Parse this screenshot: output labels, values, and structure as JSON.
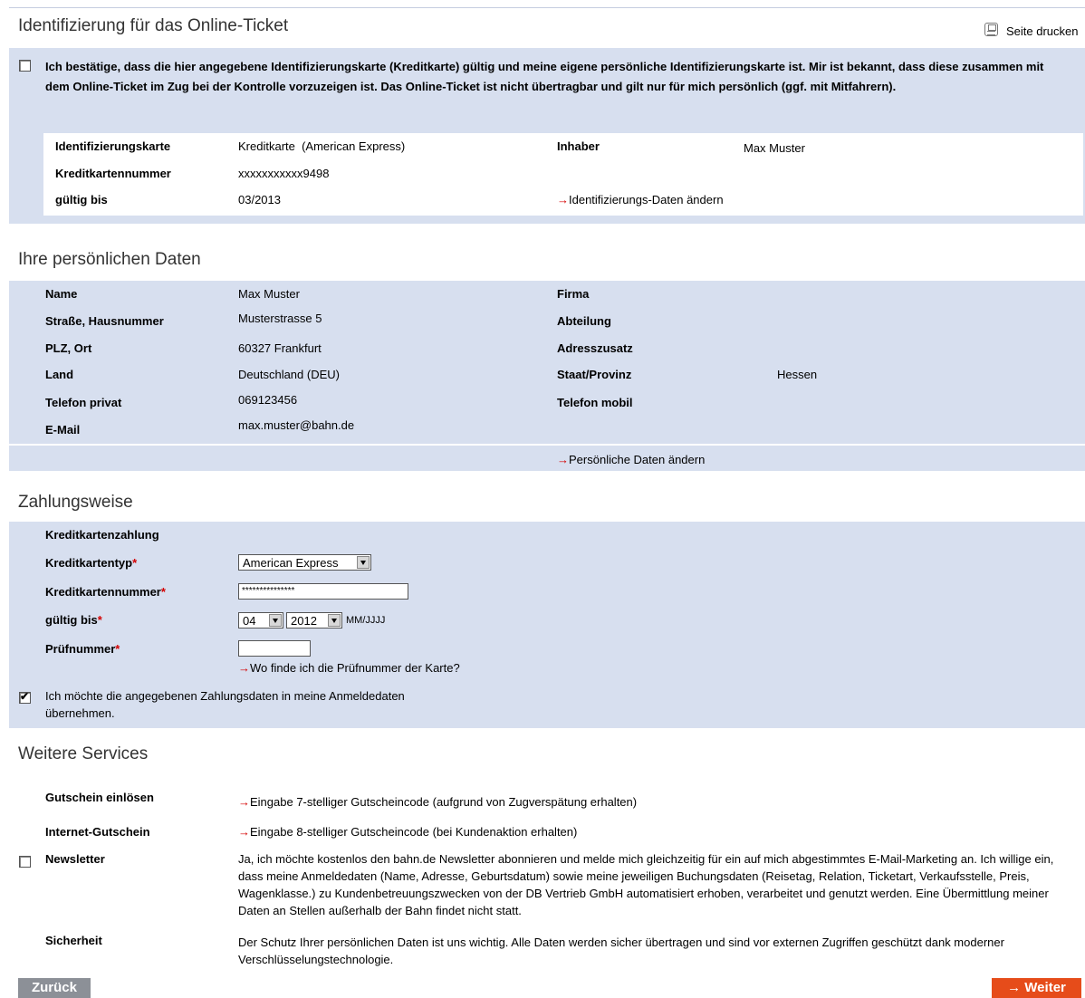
{
  "ident": {
    "title": "Identifizierung für das Online-Ticket",
    "print_label": "Seite drucken",
    "confirm_text": "Ich bestätige, dass die hier angegebene Identifizierungskarte (Kreditkarte) gültig und meine eigene persönliche Identifizierungskarte ist. Mir ist bekannt, dass diese zusammen mit dem Online-Ticket im Zug bei der Kontrolle vorzuzeigen ist. Das Online-Ticket ist nicht übertragbar und gilt nur für mich persönlich (ggf. mit Mitfahrern).",
    "card_label": "Identifizierungskarte",
    "card_value": "Kreditkarte  (American Express)",
    "owner_label": "Inhaber",
    "owner_value": "Max Muster",
    "number_label": "Kreditkartennummer",
    "number_value": "xxxxxxxxxxx9498",
    "valid_label": "gültig bis",
    "valid_value": "03/2013",
    "change_link": "Identifizierungs-Daten ändern"
  },
  "personal": {
    "title": "Ihre persönlichen Daten",
    "name_label": "Name",
    "name_value": "Max Muster",
    "company_label": "Firma",
    "street_label": "Straße, Hausnummer",
    "street_value": "Musterstrasse 5",
    "department_label": "Abteilung",
    "city_label": "PLZ, Ort",
    "city_value": "60327 Frankfurt",
    "address_extra_label": "Adresszusatz",
    "country_label": "Land",
    "country_value": "Deutschland (DEU)",
    "state_label": "Staat/Provinz",
    "state_value": "Hessen",
    "phone_label": "Telefon privat",
    "phone_value": "069123456",
    "mobile_label": "Telefon mobil",
    "email_label": "E-Mail",
    "email_value": "max.muster@bahn.de",
    "change_link": "Persönliche Daten ändern"
  },
  "payment": {
    "title": "Zahlungsweise",
    "method": "Kreditkartenzahlung",
    "type_label": "Kreditkartentyp",
    "type_value": "American Express",
    "number_label": "Kreditkartennummer",
    "number_value": "***************",
    "valid_label": "gültig bis",
    "month_value": "04",
    "year_value": "2012",
    "format_hint": "MM/JJJJ",
    "cvc_label": "Prüfnummer",
    "cvc_help_link": "Wo finde ich die Prüfnummer der Karte?",
    "save_line1": "Ich möchte die angegebenen Zahlungsdaten in meine Anmeldedaten",
    "save_line2": "übernehmen.",
    "required_mark": "*"
  },
  "services": {
    "title": "Weitere Services",
    "voucher_label": "Gutschein einlösen",
    "voucher_link": "Eingabe 7-stelliger Gutscheincode (aufgrund von Zugverspätung erhalten)",
    "internet_label": "Internet-Gutschein",
    "internet_link": "Eingabe 8-stelliger Gutscheincode (bei Kundenaktion erhalten)",
    "newsletter_label": "Newsletter",
    "newsletter_text": "Ja, ich möchte kostenlos den bahn.de Newsletter abonnieren und melde mich gleichzeitig für ein auf mich abgestimmtes E-Mail-Marketing an. Ich willige ein, dass meine Anmeldedaten (Name, Adresse, Geburtsdatum) sowie meine jeweiligen Buchungsdaten (Reisetag, Relation, Ticketart, Verkaufsstelle, Preis, Wagenklasse.) zu Kundenbetreuungszwecken von der DB Vertrieb GmbH automatisiert erhoben, verarbeitet und genutzt werden. Eine Übermittlung meiner Daten an Stellen außerhalb der Bahn findet nicht statt.",
    "security_label": "Sicherheit",
    "security_text": "Der Schutz Ihrer persönlichen Daten ist uns wichtig. Alle Daten werden sicher übertragen und sind vor externen Zugriffen geschützt dank moderner Verschlüsselungstechnologie."
  },
  "nav": {
    "back_label": "Zurück",
    "next_label": "Weiter",
    "arrow": "→"
  },
  "colors": {
    "band": "#d7dfef",
    "accent": "#d40000",
    "next_button": "#e64c1a",
    "back_button": "#8c9097"
  }
}
